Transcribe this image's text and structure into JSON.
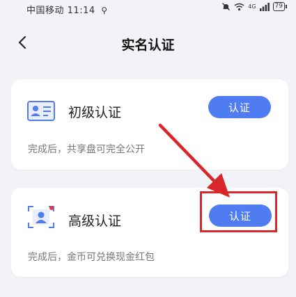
{
  "status_bar": {
    "carrier": "中国移动",
    "time": "11:14",
    "network_tag": "4G",
    "battery": "79"
  },
  "nav": {
    "title": "实名认证"
  },
  "cards": [
    {
      "title": "初级认证",
      "description": "完成后，共享盘可完全公开",
      "button_label": "认证",
      "icon": "id-card-icon"
    },
    {
      "title": "高级认证",
      "description": "完成后，金币可兑换现金红包",
      "button_label": "认证",
      "icon": "face-scan-icon"
    }
  ],
  "colors": {
    "accent": "#4f7cf0",
    "annotation": "#d9262a",
    "background": "#f2f3f6"
  }
}
